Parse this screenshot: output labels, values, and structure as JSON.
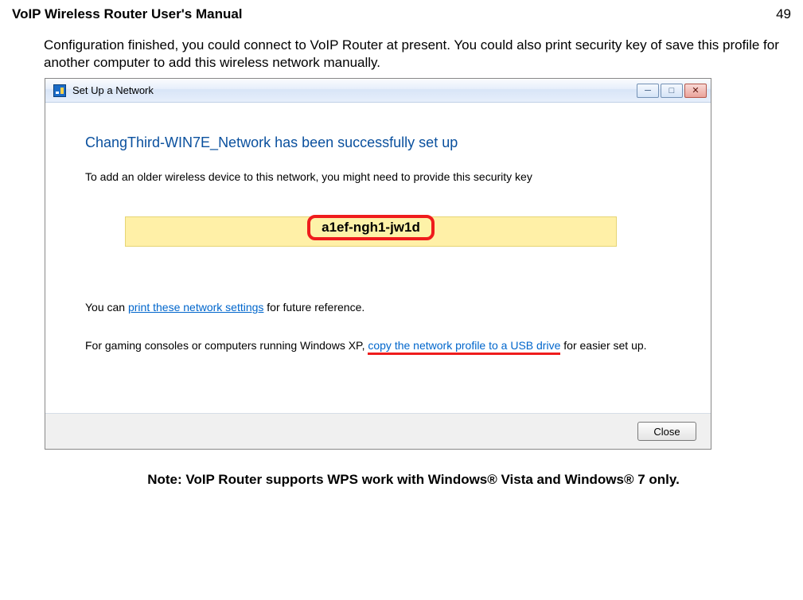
{
  "header": {
    "manual_title": "VoIP Wireless Router User's Manual",
    "page_number": "49"
  },
  "intro": "Configuration finished, you could connect to VoIP Router at present. You could also print security key of save this profile for another computer to add this wireless network manually.",
  "dialog": {
    "window_title": "Set Up a Network",
    "heading": "ChangThird-WIN7E_Network has been successfully set up",
    "security_subtext": "To add an older wireless device to this network, you might need to provide this security key",
    "security_key": "a1ef-ngh1-jw1d",
    "print_prefix": "You can ",
    "print_link": "print these network settings",
    "print_suffix": " for future reference.",
    "xp_prefix": "For gaming consoles or computers running Windows XP, ",
    "xp_link": "copy the network profile to a USB drive",
    "xp_suffix": " for easier set up.",
    "close_label": "Close"
  },
  "note": "Note: VoIP Router supports WPS work with Windows®  Vista and Windows®  7 only."
}
